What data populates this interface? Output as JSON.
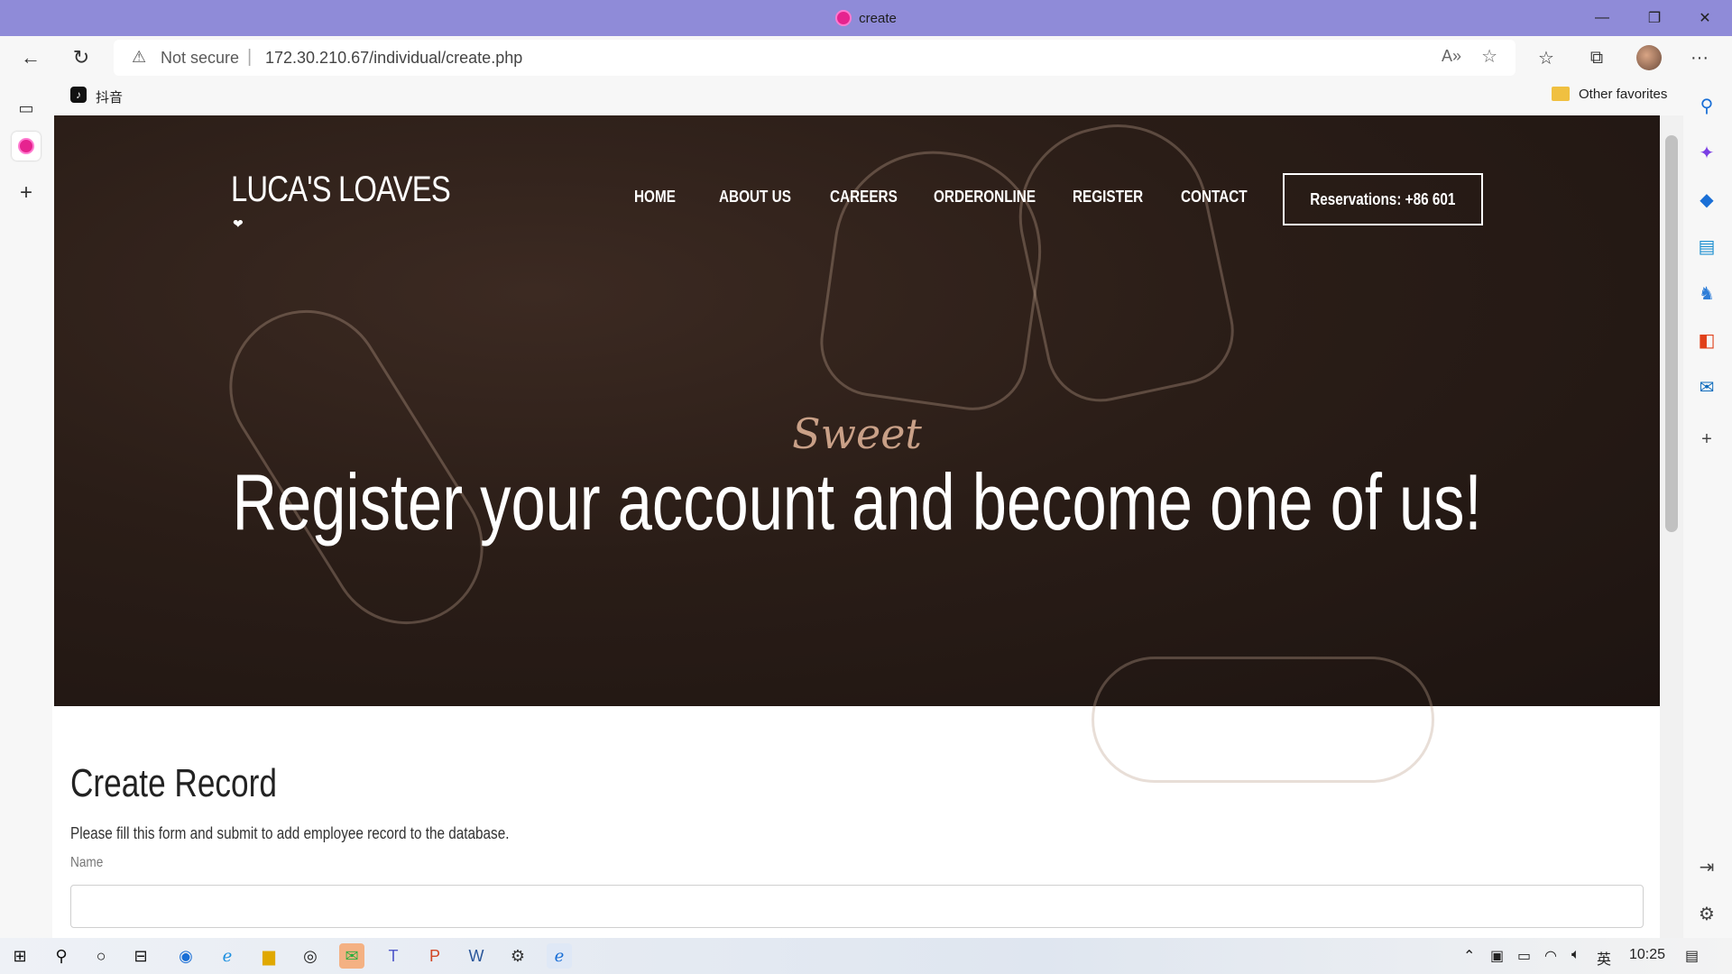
{
  "window": {
    "title": "create",
    "minimize": "—",
    "restore": "❐",
    "close": "✕"
  },
  "browser": {
    "back": "←",
    "refresh": "↻",
    "security_label": "Not secure",
    "separator": "|",
    "url": "172.30.210.67/individual/create.php",
    "more": "···"
  },
  "bookmarks": {
    "item1_label": "抖音",
    "other_favorites": "Other favorites"
  },
  "site": {
    "logo": "LUCA'S LOAVES",
    "nav": [
      "HOME",
      "ABOUT US",
      "CAREERS",
      "ORDERONLINE",
      "REGISTER",
      "CONTACT"
    ],
    "reservations": "Reservations: +86 601",
    "hero_script": "Sweet",
    "hero_heading": "Register your account and become one of us!"
  },
  "form": {
    "title": "Create Record",
    "description": "Please fill this form and submit to add employee record to the database.",
    "name_label": "Name",
    "name_value": ""
  },
  "taskbar": {
    "language": "英",
    "time": "10:25"
  },
  "colors": {
    "titlebar": "#8f8bd8",
    "hero_bg": "#2a1d17",
    "accent_script": "#c9a087"
  }
}
